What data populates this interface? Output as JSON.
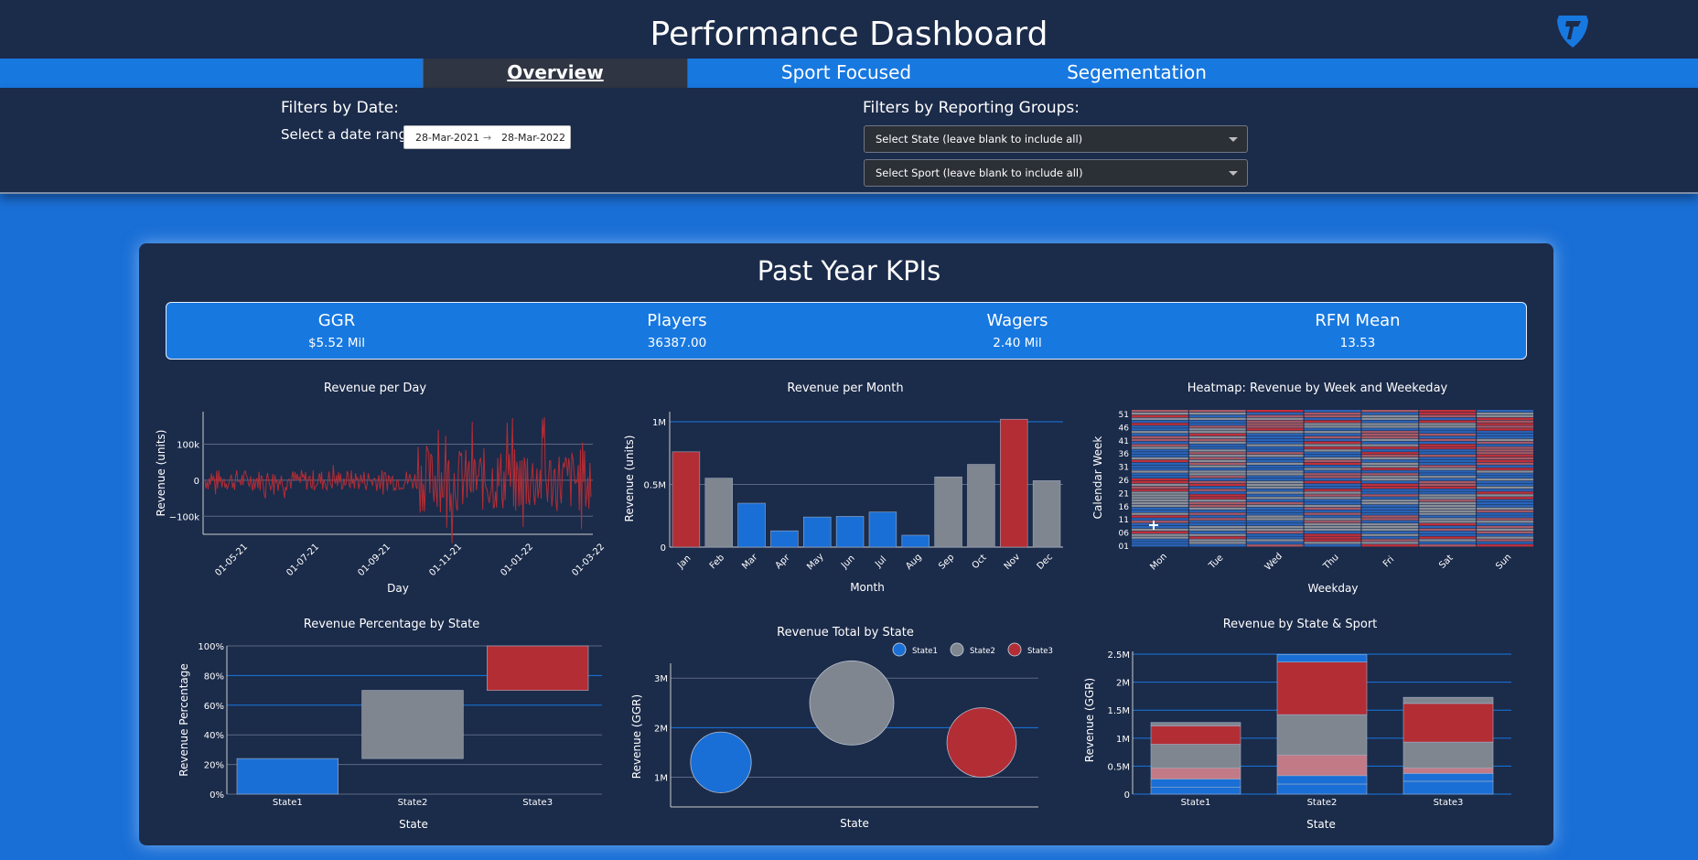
{
  "header": {
    "title": "Performance Dashboard",
    "logo_icon": "shield-logo-icon"
  },
  "nav": {
    "tabs": [
      {
        "label": "Overview",
        "active": true
      },
      {
        "label": "Sport Focused",
        "active": false
      },
      {
        "label": "Segementation",
        "active": false
      }
    ]
  },
  "filters": {
    "date_heading": "Filters by Date:",
    "date_label": "Select a date range:",
    "start_date": "28-Mar-2021",
    "end_date": "28-Mar-2022",
    "arrow": "→",
    "groups_heading": "Filters by Reporting Groups:",
    "state_select": "Select State (leave blank to include all)",
    "sport_select": "Select Sport (leave blank to include all)"
  },
  "kpis": {
    "title": "Past Year KPIs",
    "items": [
      {
        "label": "GGR",
        "value": "$5.52 Mil"
      },
      {
        "label": "Players",
        "value": "36387.00"
      },
      {
        "label": "Wagers",
        "value": "2.40 Mil"
      },
      {
        "label": "RFM Mean",
        "value": "13.53"
      }
    ]
  },
  "colors": {
    "blue": "#1a6fd6",
    "gray": "#7f8690",
    "red": "#b32d35",
    "panel": "#1b2b4a"
  },
  "chart_data": [
    {
      "type": "line",
      "title": "Revenue per Day",
      "xlabel": "Day",
      "ylabel": "Revenue (units)",
      "x_ticks": [
        "01-05-21",
        "01-07-21",
        "01-09-21",
        "01-11-21",
        "01-01-22",
        "01-03-22"
      ],
      "y_ticks": [
        "100k",
        "0",
        "−100k"
      ],
      "ylim": [
        -150000,
        190000
      ],
      "series_color": "#b32d35"
    },
    {
      "type": "bar",
      "title": "Revenue per Month",
      "xlabel": "Month",
      "ylabel": "Revenue (units)",
      "categories": [
        "Jan",
        "Feb",
        "Mar",
        "Apr",
        "May",
        "Jun",
        "Jul",
        "Aug",
        "Sep",
        "Oct",
        "Nov",
        "Dec"
      ],
      "values": [
        760000,
        550000,
        350000,
        130000,
        240000,
        245000,
        280000,
        95000,
        560000,
        660000,
        1020000,
        530000
      ],
      "bar_colors": [
        "red",
        "gray",
        "blue",
        "blue",
        "blue",
        "blue",
        "blue",
        "blue",
        "gray",
        "gray",
        "red",
        "gray"
      ],
      "y_ticks": [
        "1M",
        "0.5M",
        "0"
      ],
      "ylim": [
        0,
        1080000
      ]
    },
    {
      "type": "heatmap",
      "title": "Heatmap: Revenue by Week and Weekeday",
      "xlabel": "Weekday",
      "ylabel": "Calendar Week",
      "categories": [
        "Mon",
        "Tue",
        "Wed",
        "Thu",
        "Fri",
        "Sat",
        "Sun"
      ],
      "y_ticks": [
        "51",
        "46",
        "41",
        "36",
        "31",
        "26",
        "21",
        "16",
        "11",
        "06",
        "01"
      ]
    },
    {
      "type": "bar",
      "title": "Revenue Percentage by State",
      "xlabel": "State",
      "ylabel": "Revenue Percentage",
      "categories": [
        "State1",
        "State2",
        "State3"
      ],
      "series": [
        {
          "range": [
            0,
            24
          ]
        },
        {
          "range": [
            24,
            70
          ]
        },
        {
          "range": [
            70,
            100
          ]
        }
      ],
      "y_ticks": [
        "100%",
        "80%",
        "60%",
        "40%",
        "20%",
        "0%"
      ],
      "ylim": [
        0,
        100
      ]
    },
    {
      "type": "scatter",
      "title": "Revenue Total by State",
      "xlabel": "State",
      "ylabel": "Revenue (GGR)",
      "legend": [
        "State1",
        "State2",
        "State3"
      ],
      "points": [
        {
          "label": "State1",
          "y": 1300000,
          "size": 1300000
        },
        {
          "label": "State2",
          "y": 2500000,
          "size": 2500000
        },
        {
          "label": "State3",
          "y": 1700000,
          "size": 1700000
        }
      ],
      "y_ticks": [
        "3M",
        "2M",
        "1M"
      ],
      "ylim": [
        400000,
        3300000
      ]
    },
    {
      "type": "bar",
      "title": "Revenue by State & Sport",
      "xlabel": "State",
      "ylabel": "Revenue (GGR)",
      "categories": [
        "State1",
        "State2",
        "State3"
      ],
      "stacks": [
        [
          {
            "v": 120000,
            "c": "blue"
          },
          {
            "v": 150000,
            "c": "blue"
          },
          {
            "v": 200000,
            "c": "pink"
          },
          {
            "v": 420000,
            "c": "gray"
          },
          {
            "v": 330000,
            "c": "red"
          },
          {
            "v": 60000,
            "c": "gray"
          }
        ],
        [
          {
            "v": 180000,
            "c": "blue"
          },
          {
            "v": 150000,
            "c": "blue"
          },
          {
            "v": 370000,
            "c": "pink"
          },
          {
            "v": 720000,
            "c": "gray"
          },
          {
            "v": 940000,
            "c": "red"
          },
          {
            "v": 130000,
            "c": "blue"
          }
        ],
        [
          {
            "v": 230000,
            "c": "blue"
          },
          {
            "v": 140000,
            "c": "blue"
          },
          {
            "v": 100000,
            "c": "pink"
          },
          {
            "v": 460000,
            "c": "gray"
          },
          {
            "v": 690000,
            "c": "red"
          },
          {
            "v": 110000,
            "c": "gray"
          }
        ]
      ],
      "y_ticks": [
        "2.5M",
        "2M",
        "1.5M",
        "1M",
        "0.5M",
        "0"
      ],
      "ylim": [
        0,
        2550000
      ]
    }
  ]
}
